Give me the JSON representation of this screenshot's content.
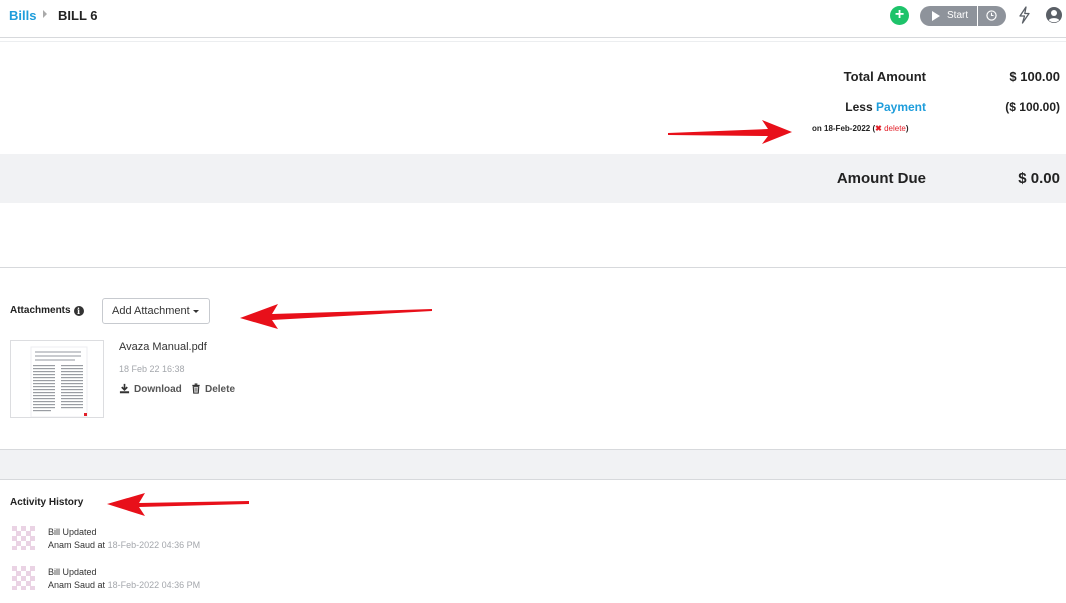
{
  "breadcrumb": {
    "parent": "Bills",
    "current": "BILL 6"
  },
  "toolbar": {
    "add_label": "+",
    "start_label": "Start"
  },
  "summary": {
    "total_label": "Total Amount",
    "total_value": "$ 100.00",
    "less_label": "Less",
    "payment_link": "Payment",
    "payment_value": "($ 100.00)",
    "payment_date": "on 18-Feb-2022",
    "delete_label": "delete",
    "due_label": "Amount Due",
    "due_value": "$ 0.00"
  },
  "attachments": {
    "title": "Attachments",
    "add_button": "Add Attachment",
    "file": {
      "name": "Avaza Manual.pdf",
      "date": "18 Feb 22 16:38",
      "download_label": "Download",
      "delete_label": "Delete"
    }
  },
  "activity": {
    "title": "Activity History",
    "items": [
      {
        "title": "Bill Updated",
        "user": "Anam Saud",
        "at": "at",
        "time": "18-Feb-2022 04:36 PM"
      },
      {
        "title": "Bill Updated",
        "user": "Anam Saud",
        "at": "at",
        "time": "18-Feb-2022 04:36 PM"
      }
    ]
  },
  "colors": {
    "accent": "#1e9ddb",
    "add": "#1dc36a",
    "danger": "#e2202a",
    "arrow": "#e8101a"
  }
}
